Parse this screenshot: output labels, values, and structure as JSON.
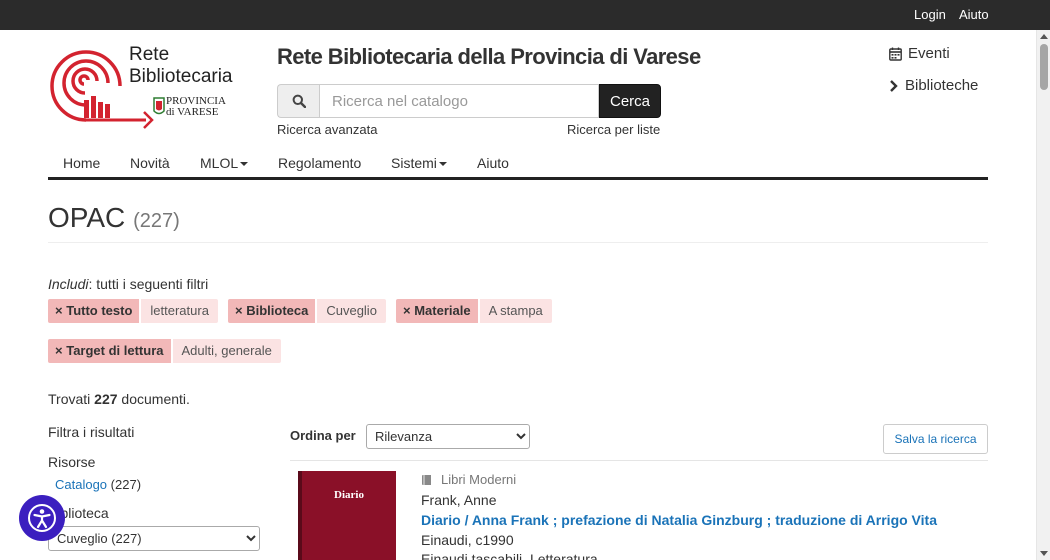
{
  "topbar": {
    "login": "Login",
    "help": "Aiuto"
  },
  "logo": {
    "line1": "Rete",
    "line2": "Bibliotecaria",
    "province_line1": "PROVINCIA",
    "province_line2": "di VARESE"
  },
  "header": {
    "site_title": "Rete Bibliotecaria della Provincia di Varese",
    "search": {
      "placeholder": "Ricerca nel catalogo",
      "value": "",
      "button": "Cerca"
    },
    "advanced_search": "Ricerca avanzata",
    "list_search": "Ricerca per liste",
    "side_links": [
      {
        "label": "Eventi",
        "icon": "calendar-icon"
      },
      {
        "label": "Biblioteche",
        "icon": "chevron-right-icon"
      }
    ]
  },
  "nav": [
    {
      "label": "Home",
      "dropdown": false
    },
    {
      "label": "Novità",
      "dropdown": false
    },
    {
      "label": "MLOL",
      "dropdown": true
    },
    {
      "label": "Regolamento",
      "dropdown": false
    },
    {
      "label": "Sistemi",
      "dropdown": true
    },
    {
      "label": "Aiuto",
      "dropdown": false
    }
  ],
  "page": {
    "title": "OPAC",
    "count": "(227)"
  },
  "filters": {
    "intro_em": "Includi",
    "intro_rest": ": tutti i seguenti filtri",
    "remove_symbol": "×",
    "items": [
      {
        "key": "Tutto testo",
        "value": "letteratura"
      },
      {
        "key": "Biblioteca",
        "value": "Cuveglio"
      },
      {
        "key": "Materiale",
        "value": "A stampa"
      },
      {
        "key": "Target di lettura",
        "value": "Adulti, generale"
      }
    ]
  },
  "results": {
    "found_prefix": "Trovati",
    "found_count": "227",
    "found_suffix": "documenti.",
    "filter_title": "Filtra i risultati",
    "resources_label": "Risorse",
    "catalog_link": "Catalogo",
    "catalog_count": "(227)",
    "library_label": "Biblioteca",
    "library_selected": "Cuveglio (227)",
    "sort_label": "Ordina per",
    "sort_selected": "Rilevanza",
    "save_search": "Salva la ricerca"
  },
  "record": {
    "cover_title": "Diario",
    "material": "Libri Moderni",
    "author": "Frank, Anne",
    "title": "Diario / Anna Frank ; prefazione di Natalia Ginzburg ; traduzione di Arrigo Vita",
    "publisher": "Einaudi, c1990",
    "series": "Einaudi tascabili. Letteratura"
  },
  "colors": {
    "link": "#1a73b8",
    "filter_key_bg": "#f2b8b8",
    "filter_value_bg": "#fbe3e3",
    "accessibility": "#3b1fbf",
    "logo_red": "#d3232f"
  }
}
